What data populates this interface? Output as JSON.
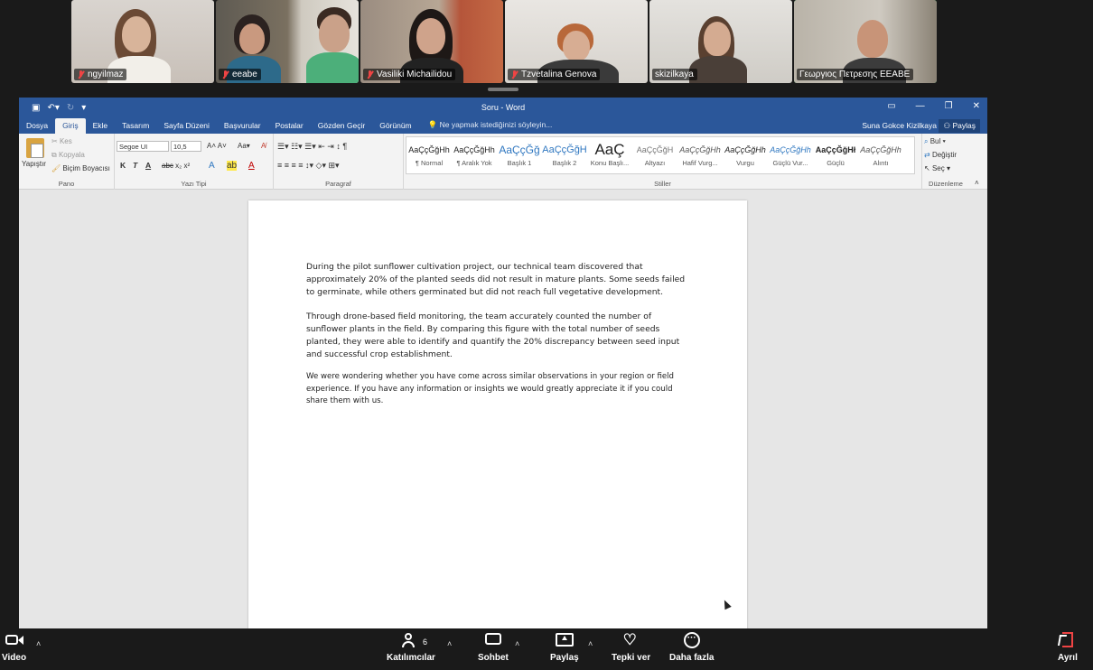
{
  "participants": [
    {
      "name": "ngyilmaz",
      "muted": true
    },
    {
      "name": "eeabe",
      "muted": true
    },
    {
      "name": "Vasiliki Michailidou",
      "muted": true
    },
    {
      "name": "Tzvetalina Genova",
      "muted": true
    },
    {
      "name": "skizilkaya",
      "muted": false
    },
    {
      "name": "Γεωργιος Πετρεσης ΕΕΑΒΕ",
      "muted": false,
      "active_speaker": true
    }
  ],
  "word": {
    "title": "Soru - Word",
    "tabs": [
      "Dosya",
      "Giriş",
      "Ekle",
      "Tasarım",
      "Sayfa Düzeni",
      "Başvurular",
      "Postalar",
      "Gözden Geçir",
      "Görünüm"
    ],
    "active_tab": "Giriş",
    "tell_me": "Ne yapmak istediğinizi söyleyin...",
    "user": "Suna Gokce Kizilkaya",
    "share": "Paylaş",
    "clipboard": {
      "paste": "Yapıştır",
      "cut": "Kes",
      "copy": "Kopyala",
      "format_painter": "Biçim Boyacısı",
      "group": "Pano"
    },
    "font": {
      "family": "Segoe UI",
      "size": "10,5",
      "group": "Yazı Tipi",
      "bold": "K",
      "italic": "T",
      "underline": "A"
    },
    "paragraph_group": "Paragraf",
    "styles_group": "Stiller",
    "styles": [
      {
        "sample": "AaÇçĞğHh",
        "name": "¶ Normal"
      },
      {
        "sample": "AaÇçĞğHh",
        "name": "¶ Aralık Yok"
      },
      {
        "sample": "AaÇçĞğ",
        "name": "Başlık 1"
      },
      {
        "sample": "AaÇçĞğH",
        "name": "Başlık 2"
      },
      {
        "sample": "AaÇ",
        "name": "Konu Başlı..."
      },
      {
        "sample": "AaÇçĞğH",
        "name": "Altyazı"
      },
      {
        "sample": "AaÇçĞğHh",
        "name": "Hafif Vurg..."
      },
      {
        "sample": "AaÇçĞğHh",
        "name": "Vurgu"
      },
      {
        "sample": "AaÇçĞğHh",
        "name": "Güçlü Vur..."
      },
      {
        "sample": "AaÇçĞğHł",
        "name": "Güçlü"
      },
      {
        "sample": "AaÇçĞğHh",
        "name": "Alıntı"
      }
    ],
    "editing": {
      "find": "Bul",
      "replace": "Değiştir",
      "select": "Seç",
      "group": "Düzenleme"
    },
    "document": {
      "p1": "During the pilot sunflower cultivation project, our technical team discovered that approximately 20% of the planted seeds did not result in mature plants. Some seeds failed to germinate, while others germinated but did not reach full vegetative development.",
      "p2": "Through drone-based field monitoring, the team accurately counted the number of sunflower plants in the field. By comparing this figure with the total number of seeds planted, they were able to identify and quantify the 20% discrepancy between seed input and successful crop establishment.",
      "p3": "We were wondering whether you have come across similar observations in your region or field experience. If you have any information or insights we would greatly appreciate it if you could share them with us."
    }
  },
  "toolbar": {
    "video": "Video",
    "participants": "Katılımcılar",
    "participants_count": "6",
    "chat": "Sohbet",
    "share": "Paylaş",
    "react": "Tepki ver",
    "more": "Daha fazla",
    "leave": "Ayrıl"
  }
}
